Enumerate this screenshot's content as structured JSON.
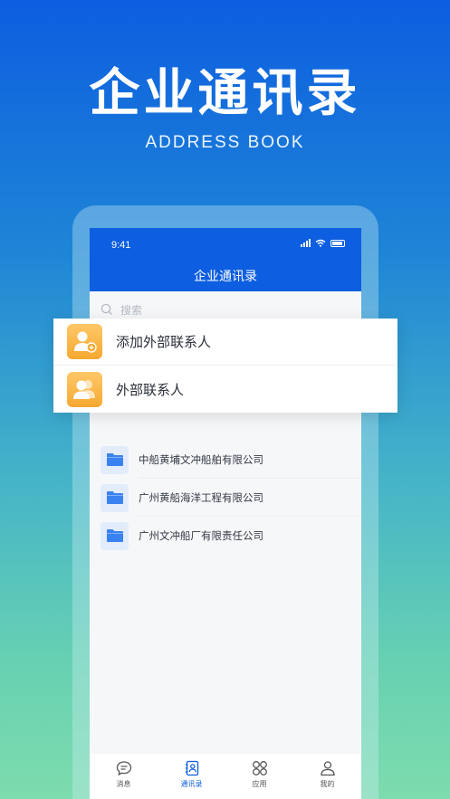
{
  "hero": {
    "title": "企业通讯录",
    "subtitle": "ADDRESS BOOK"
  },
  "status_bar": {
    "time": "9:41"
  },
  "app_header": {
    "title": "企业通讯录"
  },
  "search": {
    "placeholder": "搜索"
  },
  "quick_actions": [
    {
      "label": "添加外部联系人",
      "icon": "add-contact-icon"
    },
    {
      "label": "外部联系人",
      "icon": "contacts-icon"
    }
  ],
  "companies": [
    {
      "name": "中船黄埔文冲船舶有限公司",
      "icon": "folder-icon"
    },
    {
      "name": "广州黄船海洋工程有限公司",
      "icon": "folder-icon"
    },
    {
      "name": "广州文冲船厂有限责任公司",
      "icon": "folder-icon"
    }
  ],
  "tabs": [
    {
      "label": "消息",
      "icon": "message-icon",
      "active": false
    },
    {
      "label": "通讯录",
      "icon": "address-book-icon",
      "active": true
    },
    {
      "label": "应用",
      "icon": "apps-icon",
      "active": false
    },
    {
      "label": "我的",
      "icon": "profile-icon",
      "active": false
    }
  ],
  "colors": {
    "brand_blue": "#0d5ee0",
    "accent_orange": "#f6a830",
    "folder_blue": "#3a82f0"
  }
}
